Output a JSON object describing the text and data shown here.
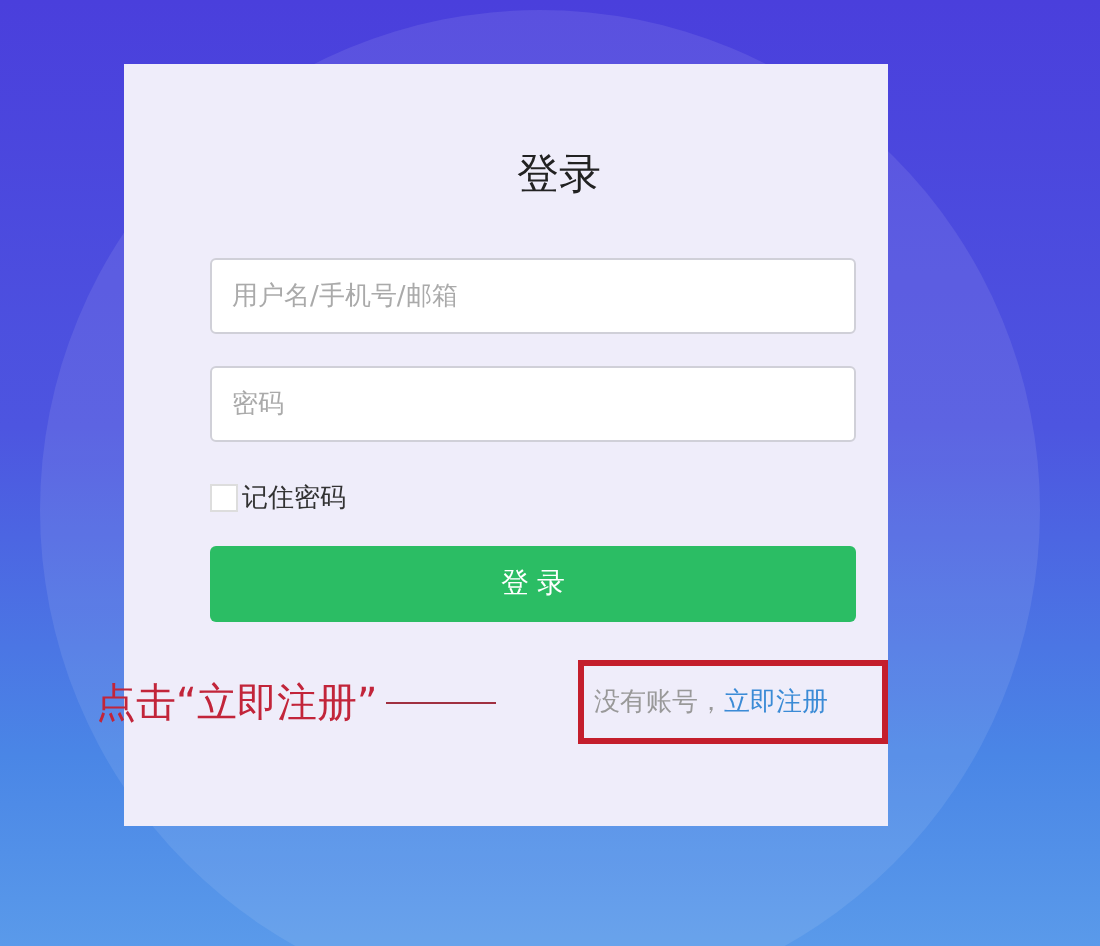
{
  "login_card": {
    "title": "登录",
    "fields": [
      {
        "placeholder": "用户名/手机号/邮箱"
      },
      {
        "placeholder": "密码"
      }
    ],
    "remember": {
      "label": "记住密码",
      "checked": false
    },
    "submit_button": "登 录",
    "register_prompt": {
      "text": "没有账号，",
      "link": "立即注册"
    }
  },
  "annotation": {
    "text": "点击“立即注册”"
  }
}
